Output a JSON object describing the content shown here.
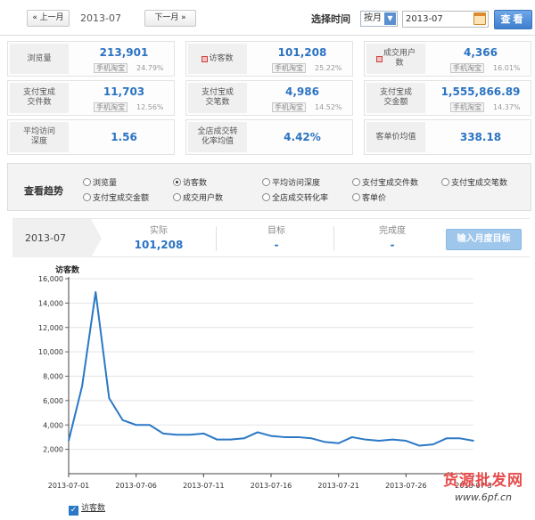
{
  "toolbar": {
    "prev_month_label": "« 上一月",
    "current_month": "2013-07",
    "next_month_label": "下一月 »",
    "select_time_label": "选择时间",
    "mode_selected": "按月",
    "date_value": "2013-07",
    "search_label": "查看"
  },
  "stats": [
    {
      "label": "浏览量",
      "value": "213,901",
      "mobile_label": "手机淘宝",
      "mobile_pct": "24.79%"
    },
    {
      "label": "访客数",
      "value": "101,208",
      "mobile_label": "手机淘宝",
      "mobile_pct": "25.22%"
    },
    {
      "label": "成交用户数",
      "value": "4,366",
      "mobile_label": "手机淘宝",
      "mobile_pct": "16.01%"
    },
    {
      "label": "支付宝成交件数",
      "value": "11,703",
      "mobile_label": "手机淘宝",
      "mobile_pct": "12.56%"
    },
    {
      "label": "支付宝成交笔数",
      "value": "4,986",
      "mobile_label": "手机淘宝",
      "mobile_pct": "14.52%"
    },
    {
      "label": "支付宝成交金额",
      "value": "1,555,866.89",
      "mobile_label": "手机淘宝",
      "mobile_pct": "14.37%"
    },
    {
      "label": "平均访问深度",
      "value": "1.56"
    },
    {
      "label": "全店成交转化率均值",
      "value": "4.42%"
    },
    {
      "label": "客单价均值",
      "value": "338.18"
    }
  ],
  "trend": {
    "label": "查看趋势",
    "options": [
      "浏览量",
      "访客数",
      "平均访问深度",
      "支付宝成交件数",
      "支付宝成交笔数",
      "支付宝成交金额",
      "成交用户数",
      "全店成交转化率",
      "客单价"
    ],
    "selected": "访客数"
  },
  "target": {
    "month": "2013-07",
    "actual_label": "实际",
    "actual_value": "101,208",
    "goal_label": "目标",
    "goal_value": "-",
    "completion_label": "完成度",
    "completion_value": "-",
    "button_label": "输入月度目标"
  },
  "chart_data": {
    "type": "line",
    "ylabel": "访客数",
    "ylim": [
      0,
      16000
    ],
    "y_ticks": [
      2000,
      4000,
      6000,
      8000,
      10000,
      12000,
      14000,
      16000
    ],
    "y_tick_labels": [
      "2,000",
      "4,000",
      "6,000",
      "8,000",
      "10,000",
      "12,000",
      "14,000",
      "16,000"
    ],
    "x_tick_labels": [
      "2013-07-01",
      "2013-07-06",
      "2013-07-11",
      "2013-07-16",
      "2013-07-21",
      "2013-07-26",
      "2013-07-3"
    ],
    "x": [
      "2013-07-01",
      "2013-07-02",
      "2013-07-03",
      "2013-07-04",
      "2013-07-05",
      "2013-07-06",
      "2013-07-07",
      "2013-07-08",
      "2013-07-09",
      "2013-07-10",
      "2013-07-11",
      "2013-07-12",
      "2013-07-13",
      "2013-07-14",
      "2013-07-15",
      "2013-07-16",
      "2013-07-17",
      "2013-07-18",
      "2013-07-19",
      "2013-07-20",
      "2013-07-21",
      "2013-07-22",
      "2013-07-23",
      "2013-07-24",
      "2013-07-25",
      "2013-07-26",
      "2013-07-27",
      "2013-07-28",
      "2013-07-29",
      "2013-07-30",
      "2013-07-31"
    ],
    "series": [
      {
        "name": "访客数",
        "color": "#2a78c6",
        "values": [
          2700,
          7200,
          14900,
          6200,
          4400,
          4000,
          4000,
          3300,
          3200,
          3200,
          3300,
          2800,
          2800,
          2900,
          3400,
          3100,
          3000,
          3000,
          2900,
          2600,
          2500,
          3000,
          2800,
          2700,
          2800,
          2700,
          2300,
          2400,
          2900,
          2900,
          2700
        ]
      }
    ],
    "legend": [
      "访客数"
    ],
    "grid": true
  },
  "watermark": {
    "line1": "货源批发网",
    "line2": "www.6pf.cn"
  },
  "colors": {
    "accent": "#2b73c2",
    "line": "#2a78c6"
  }
}
